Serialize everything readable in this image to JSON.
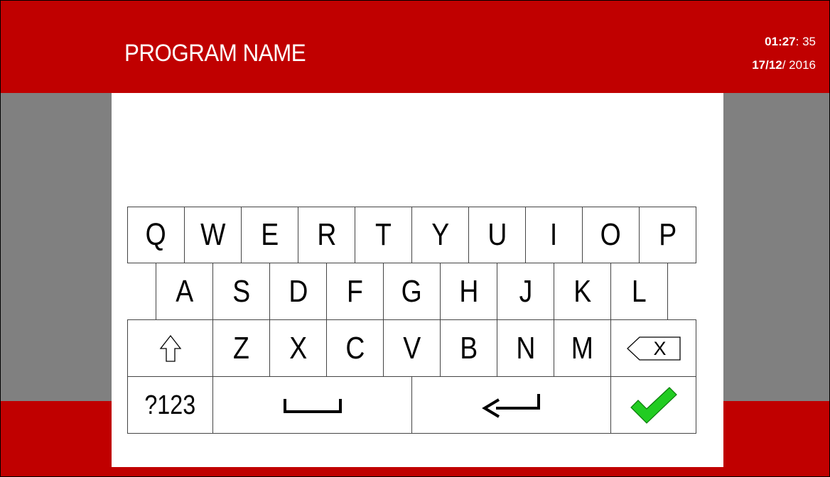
{
  "header": {
    "title": "PROGRAM NAME",
    "time_bold": "01:27",
    "time_rest": ": 35",
    "date_bold": "17/12",
    "date_rest": "/ 2016"
  },
  "keyboard": {
    "row1": [
      "Q",
      "W",
      "E",
      "R",
      "T",
      "Y",
      "U",
      "I",
      "O",
      "P"
    ],
    "row2": [
      "A",
      "S",
      "D",
      "F",
      "G",
      "H",
      "J",
      "K",
      "L"
    ],
    "row3": [
      "Z",
      "X",
      "C",
      "V",
      "B",
      "N",
      "M"
    ],
    "backspace_label": "X",
    "symbols_label": "?123"
  },
  "colors": {
    "header_bg": "#c00000",
    "side_bg": "#808080",
    "confirm_check": "#22cc22"
  }
}
